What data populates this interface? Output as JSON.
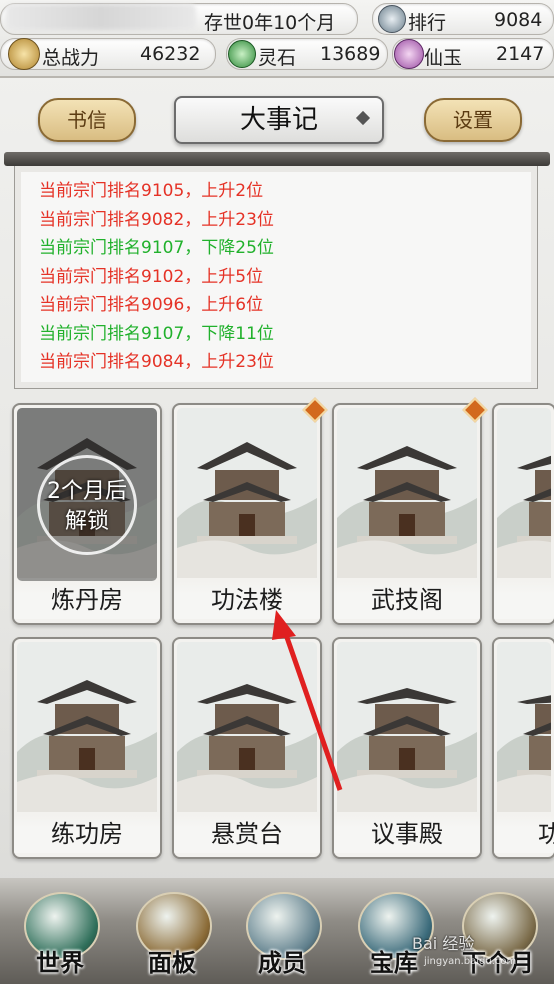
{
  "top_bar": {
    "era_label": "存世0年10个月",
    "ranking_label": "排行",
    "ranking_value": "9084",
    "power_label": "总战力",
    "power_value": "46232",
    "spirit_stone_label": "灵石",
    "spirit_stone_value": "13689",
    "jade_label": "仙玉",
    "jade_value": "2147"
  },
  "header": {
    "left_button": "书信",
    "title": "大事记",
    "right_button": "设置"
  },
  "event_log": [
    {
      "text": "当前宗门排名9105，上升2位",
      "color": "#e53226"
    },
    {
      "text": "当前宗门排名9082，上升23位",
      "color": "#e53226"
    },
    {
      "text": "当前宗门排名9107，下降25位",
      "color": "#21b12c"
    },
    {
      "text": "当前宗门排名9102，上升5位",
      "color": "#e53226"
    },
    {
      "text": "当前宗门排名9096，上升6位",
      "color": "#e53226"
    },
    {
      "text": "当前宗门排名9107，下降11位",
      "color": "#21b12c"
    },
    {
      "text": "当前宗门排名9084，上升23位",
      "color": "#e53226"
    }
  ],
  "buildings_row1": [
    {
      "name": "炼丹房",
      "locked": true,
      "lock_line1": "2个月后",
      "lock_line2": "解锁"
    },
    {
      "name": "功法楼",
      "badge": true
    },
    {
      "name": "武技阁",
      "badge": true
    },
    {
      "name": "",
      "partial": true
    }
  ],
  "buildings_row2": [
    {
      "name": "练功房"
    },
    {
      "name": "悬赏台"
    },
    {
      "name": "议事殿"
    },
    {
      "name": "功",
      "partial": true
    }
  ],
  "bottom_nav": [
    {
      "label": "世界",
      "icon": "world-icon"
    },
    {
      "label": "面板",
      "icon": "scroll-icon"
    },
    {
      "label": "成员",
      "icon": "member-icon"
    },
    {
      "label": "宝库",
      "icon": "treasury-icon"
    },
    {
      "label": "下个月",
      "icon": "next-month-icon"
    }
  ],
  "watermark": {
    "line1": "Bai 经验",
    "line2": "jingyan.baidu.com"
  },
  "colors": {
    "rise": "#e53226",
    "fall": "#21b12c",
    "accent_gold": "#d9bd82"
  }
}
